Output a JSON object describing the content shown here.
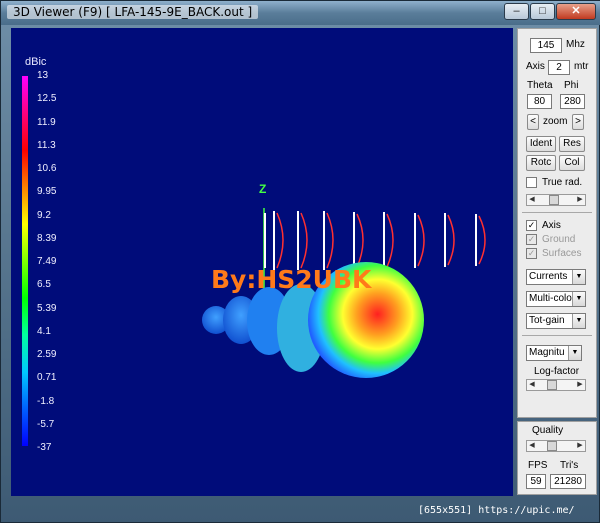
{
  "window": {
    "title": "3D Viewer (F9)   [  LFA-145-9E_BACK.out ]"
  },
  "legend": {
    "unit": "dBic",
    "ticks": [
      "13",
      "12.5",
      "11.9",
      "11.3",
      "10.6",
      "9.95",
      "9.2",
      "8.39",
      "7.49",
      "6.5",
      "5.39",
      "4.1",
      "2.59",
      "0.71",
      "-1.8",
      "-5.7",
      "-37"
    ]
  },
  "viewport": {
    "z_axis_label": "Z",
    "watermark": "By:HS2UBK"
  },
  "panel": {
    "freq_value": "145",
    "freq_unit": "Mhz",
    "axis_label": "Axis",
    "axis_value": "2",
    "axis_unit": "mtr",
    "theta_label": "Theta",
    "phi_label": "Phi",
    "theta_value": "80",
    "phi_value": "280",
    "zoom_left": "<",
    "zoom_label": "zoom",
    "zoom_right": ">",
    "ident_label": "Ident",
    "res_label": "Res",
    "rotc_label": "Rotc",
    "col_label": "Col",
    "true_rad_label": "True rad.",
    "axis_check_label": "Axis",
    "ground_label": "Ground",
    "surfaces_label": "Surfaces",
    "currents_select": "Currents",
    "color_select": "Multi-colo",
    "gain_select": "Tot-gain",
    "magnitude_select": "Magnitu",
    "log_factor_label": "Log-factor"
  },
  "quality_panel": {
    "quality_label": "Quality",
    "fps_label": "FPS",
    "tris_label": "Tri's",
    "fps_value": "59",
    "tris_value": "21280"
  },
  "footer": {
    "text": "[655x551] https://upic.me/"
  }
}
